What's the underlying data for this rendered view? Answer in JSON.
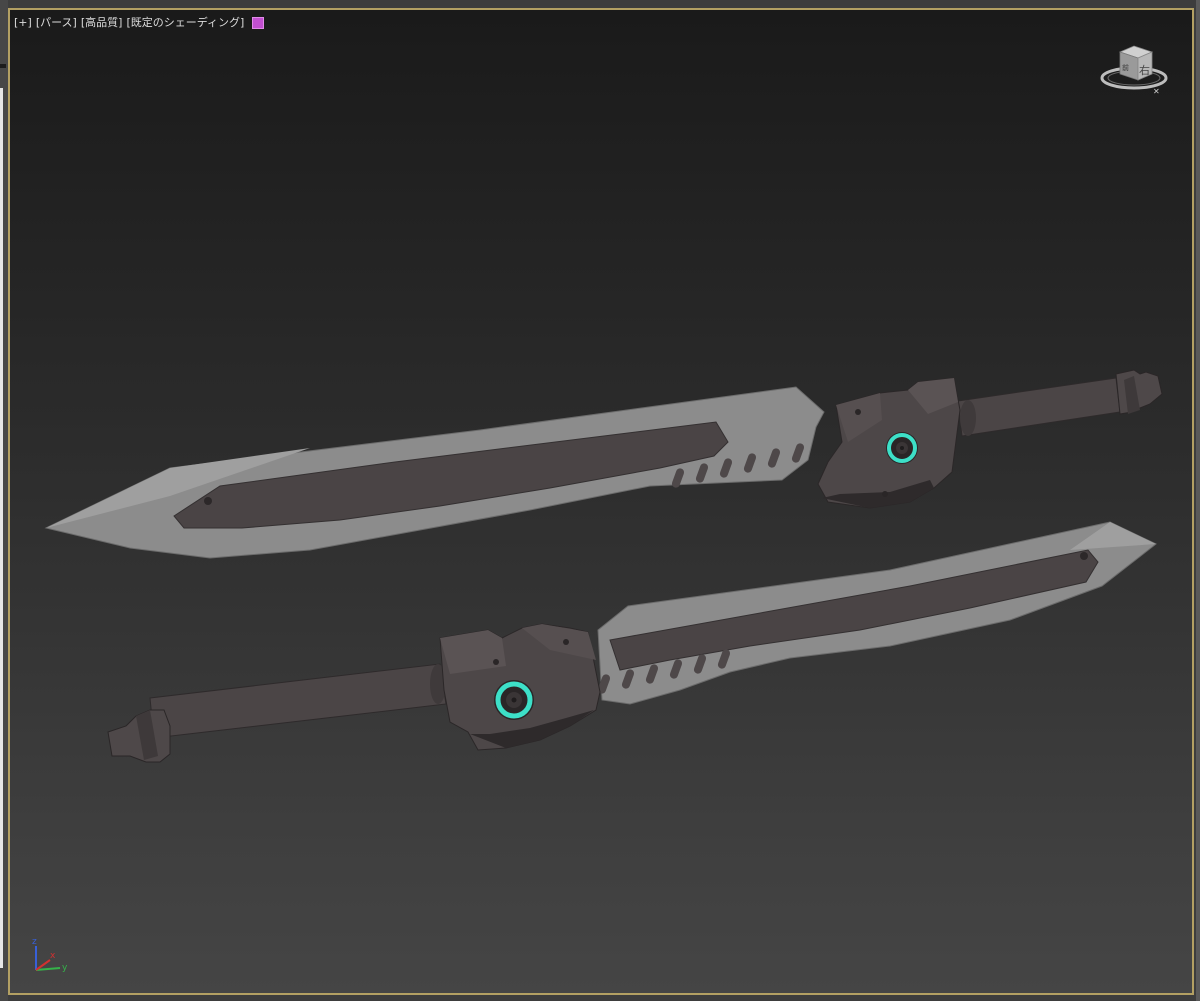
{
  "viewport": {
    "menu_plus": "[+]",
    "view_mode": "[パース]",
    "quality": "[高品質]",
    "shading": "[既定のシェーディング]",
    "shading_color": "#c24fd1",
    "border_color": "#b3a063"
  },
  "viewcube": {
    "face_right": "右",
    "face_front": "前"
  },
  "axis": {
    "z": "z",
    "x": "x",
    "y": "y",
    "colors": {
      "x": "#d23030",
      "y": "#35b34a",
      "z": "#3860d8"
    }
  },
  "scene": {
    "objects": [
      "sword-upper",
      "sword-lower"
    ],
    "accent_color": "#3de0c8"
  }
}
